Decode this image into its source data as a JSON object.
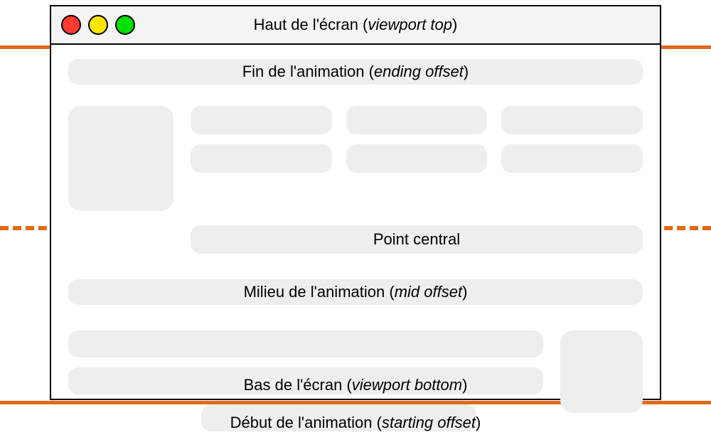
{
  "titlebar": {
    "label_fr": "Haut de l'écran",
    "label_en": "viewport top"
  },
  "rows": {
    "end": {
      "label_fr": "Fin de l'animation",
      "label_en": "ending offset"
    },
    "center": {
      "label": "Point central"
    },
    "mid": {
      "label_fr": "Milieu de l'animation",
      "label_en": "mid offset"
    },
    "viewport_bottom": {
      "label_fr": "Bas de l'écran",
      "label_en": "viewport bottom"
    },
    "start": {
      "label_fr": "Début de l'animation",
      "label_en": "starting offset"
    }
  },
  "colors": {
    "line": "#e06a1a",
    "skeleton": "#eeeeee"
  }
}
